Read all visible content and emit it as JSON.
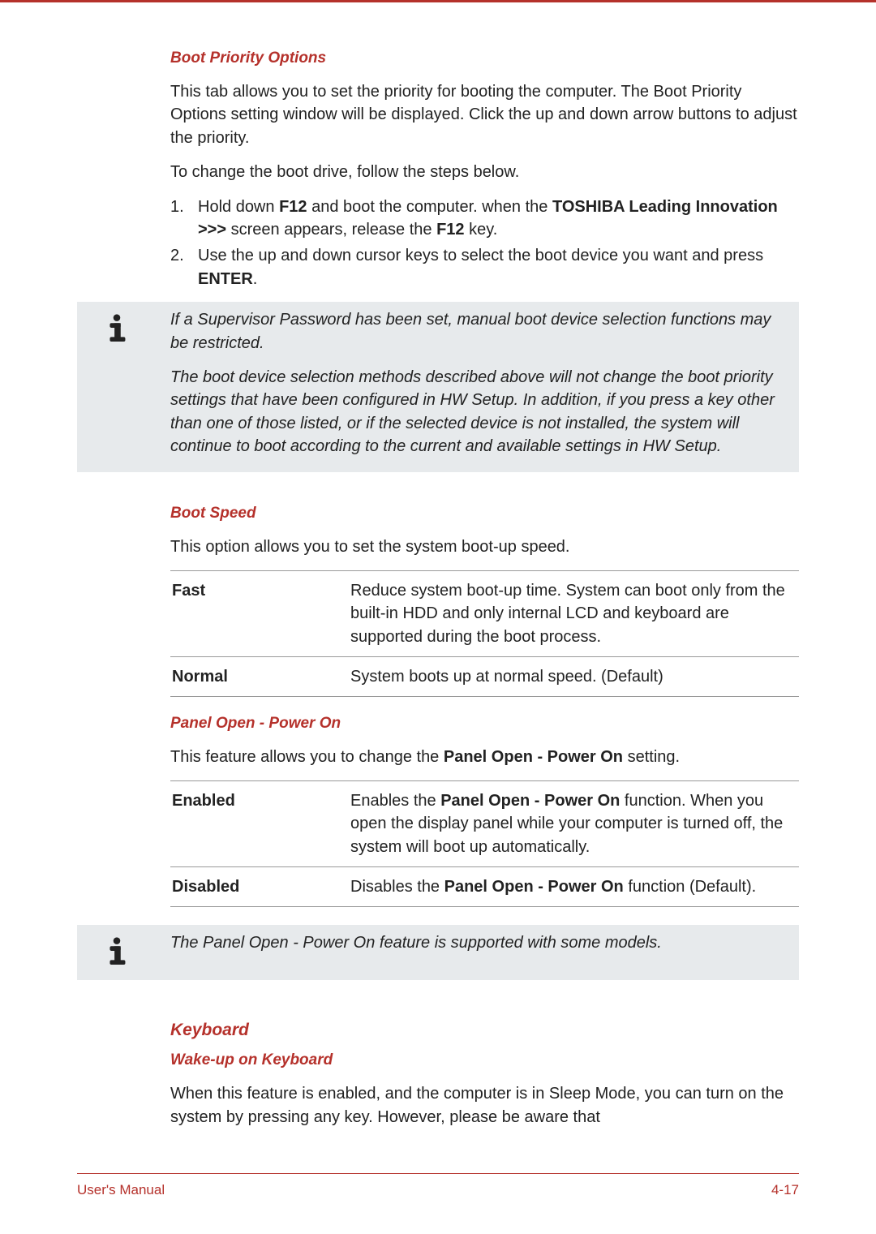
{
  "sections": {
    "bootPriority": {
      "heading": "Boot Priority Options",
      "p1": "This tab allows you to set the priority for booting the computer. The Boot Priority Options setting window will be displayed. Click the up and down arrow buttons to adjust the priority.",
      "p2": "To change the boot drive, follow the steps below.",
      "list": [
        {
          "num": "1.",
          "pre": "Hold down ",
          "b1": "F12",
          "mid": " and boot the computer. when the ",
          "b2": "TOSHIBA Leading Innovation >>>",
          "mid2": " screen appears, release the ",
          "b3": "F12",
          "post": " key."
        },
        {
          "num": "2.",
          "pre": "Use the up and down cursor keys to select the boot device you want and press ",
          "b1": "ENTER",
          "post": "."
        }
      ],
      "note1": "If a Supervisor Password has been set, manual boot device selection functions may be restricted.",
      "note2": "The boot device selection methods described above will not change the boot priority settings that have been configured in HW Setup. In addition, if you press a key other than one of those listed, or if the selected device is not installed, the system will continue to boot according to the current and available settings in HW Setup."
    },
    "bootSpeed": {
      "heading": "Boot Speed",
      "p1": "This option allows you to set the system boot-up speed.",
      "rows": [
        {
          "term": "Fast",
          "desc": "Reduce system boot-up time. System can boot only from the built-in HDD and only internal LCD and keyboard are supported during the boot process."
        },
        {
          "term": "Normal",
          "desc": "System boots up at normal speed. (Default)"
        }
      ]
    },
    "panelOpen": {
      "heading": "Panel Open - Power On",
      "p1_pre": "This feature allows you to change the ",
      "p1_b": "Panel Open - Power On",
      "p1_post": " setting.",
      "rows": [
        {
          "term": "Enabled",
          "pre": "Enables the ",
          "b": "Panel Open - Power On",
          "post": " function. When you open the display panel while your computer is turned off, the system will boot up automatically."
        },
        {
          "term": "Disabled",
          "pre": "Disables the ",
          "b": "Panel Open - Power On",
          "post": " function (Default)."
        }
      ],
      "note": "The Panel Open - Power On feature is supported with some models."
    },
    "keyboard": {
      "heading": "Keyboard",
      "subheading": "Wake-up on Keyboard",
      "p1": "When this feature is enabled, and the computer is in Sleep Mode, you can turn on the system by pressing any key. However, please be aware that"
    }
  },
  "footer": {
    "left": "User's Manual",
    "right": "4-17"
  }
}
